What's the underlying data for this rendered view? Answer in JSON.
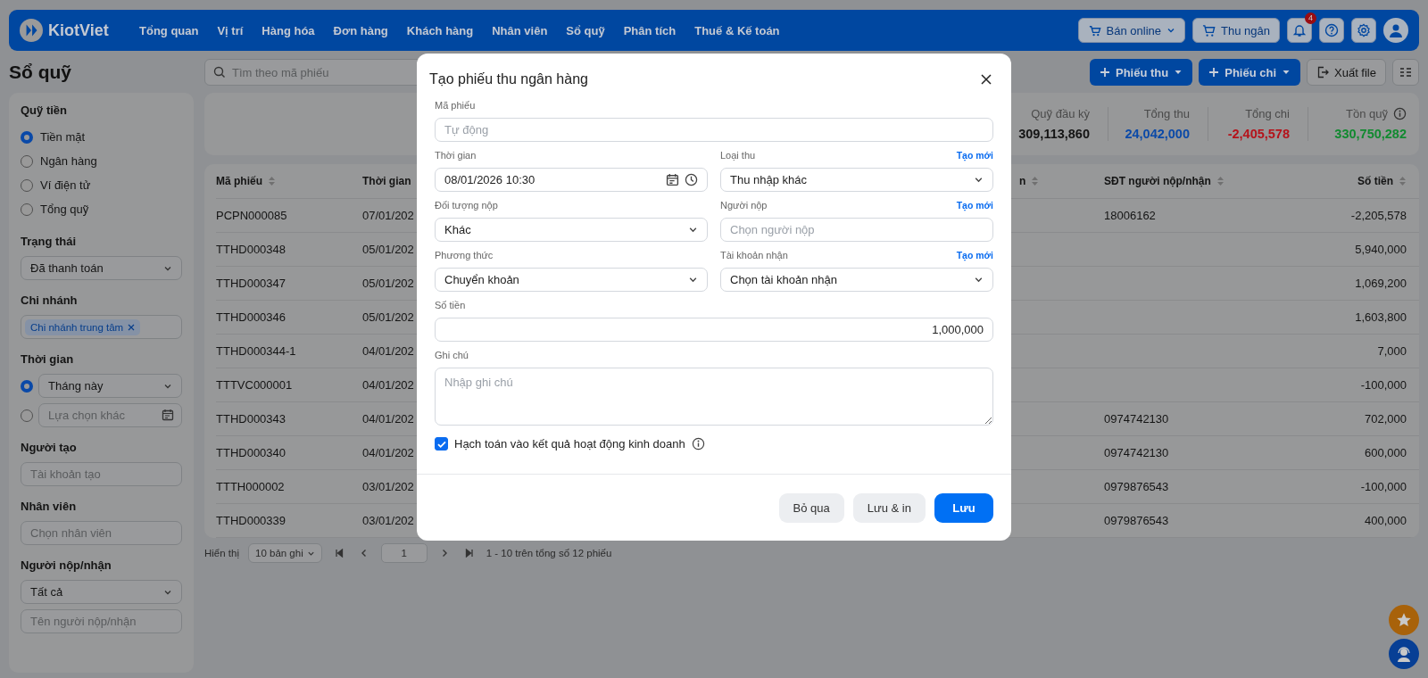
{
  "nav": {
    "logo": "KiotViet",
    "items": [
      {
        "label": "Tổng quan"
      },
      {
        "label": "Vị trí"
      },
      {
        "label": "Hàng hóa"
      },
      {
        "label": "Đơn hàng"
      },
      {
        "label": "Khách hàng"
      },
      {
        "label": "Nhân viên"
      },
      {
        "label": "Sổ quỹ"
      },
      {
        "label": "Phân tích"
      },
      {
        "label": "Thuế & Kế toán"
      }
    ],
    "online_button": "Bán online",
    "cashier_button": "Thu ngân",
    "notification_count": "4"
  },
  "page": {
    "title": "Sổ quỹ",
    "search": {
      "placeholder": "Tìm theo mã phiếu"
    },
    "receipt_button": "Phiếu thu",
    "payment_button": "Phiếu chi",
    "export_button": "Xuất file"
  },
  "sidebar": {
    "sections": [
      {
        "kind": "radios",
        "title": "Quỹ tiền",
        "options": [
          {
            "label": "Tiền mặt",
            "selected": true
          },
          {
            "label": "Ngân hàng",
            "selected": false
          },
          {
            "label": "Ví điện tử",
            "selected": false
          },
          {
            "label": "Tổng quỹ",
            "selected": false
          }
        ]
      },
      {
        "kind": "select",
        "title": "Trạng thái",
        "value": "Đã thanh toán"
      },
      {
        "kind": "tags",
        "title": "Chi nhánh",
        "tags": [
          "Chi nhánh trung tâm"
        ]
      },
      {
        "kind": "time",
        "title": "Thời gian",
        "options": [
          {
            "kind": "select",
            "value": "Tháng này",
            "selected": true
          },
          {
            "kind": "date",
            "placeholder": "Lựa chọn khác",
            "selected": false
          }
        ]
      },
      {
        "kind": "input",
        "title": "Người tạo",
        "placeholder": "Tài khoản tạo"
      },
      {
        "kind": "input",
        "title": "Nhân viên",
        "placeholder": "Chọn nhân viên"
      },
      {
        "kind": "select_input",
        "title": "Người nộp/nhận",
        "value": "Tất cả",
        "placeholder": "Tên người nộp/nhận"
      }
    ]
  },
  "summary": [
    {
      "label": "Quỹ đầu kỳ",
      "value": "309,113,860",
      "color": "#141414",
      "info": false
    },
    {
      "label": "Tổng thu",
      "value": "24,042,000",
      "color": "#0a49a8",
      "info": false
    },
    {
      "label": "Tổng chi",
      "value": "-2,405,578",
      "color": "#b5121a",
      "info": false
    },
    {
      "label": "Tồn quỹ",
      "value": "330,750,282",
      "color": "#118a30",
      "info": true
    }
  ],
  "table": {
    "columns": [
      {
        "label": "Mã phiếu"
      },
      {
        "label": "Thời gian"
      },
      {
        "label": "n"
      },
      {
        "label": "SĐT người nộp/nhận"
      },
      {
        "label": "Số tiền"
      }
    ],
    "rows": [
      {
        "code": "PCPN000085",
        "time": "07/01/202",
        "phone": "18006162",
        "amount": "-2,205,578"
      },
      {
        "code": "TTHD000348",
        "time": "05/01/202",
        "amount": "5,940,000"
      },
      {
        "code": "TTHD000347",
        "time": "05/01/202",
        "amount": "1,069,200"
      },
      {
        "code": "TTHD000346",
        "time": "05/01/202",
        "amount": "1,603,800"
      },
      {
        "code": "TTHD000344-1",
        "time": "04/01/202",
        "amount": "7,000"
      },
      {
        "code": "TTTVC000001",
        "time": "04/01/202",
        "amount": "-100,000"
      },
      {
        "code": "TTHD000343",
        "time": "04/01/202",
        "phone": "0974742130",
        "amount": "702,000"
      },
      {
        "code": "TTHD000340",
        "time": "04/01/202",
        "phone": "0974742130",
        "amount": "600,000"
      },
      {
        "code": "TTTH000002",
        "time": "03/01/202",
        "phone": "0979876543",
        "amount": "-100,000"
      },
      {
        "code": "TTHD000339",
        "time": "03/01/202",
        "phone": "0979876543",
        "amount": "400,000"
      }
    ]
  },
  "pagination": {
    "label": "Hiển thị",
    "page_size": "10 bản ghi",
    "page": "1",
    "summary": "1 - 10 trên tổng số 12 phiếu"
  },
  "modal": {
    "title": "Tạo phiếu thu ngân hàng",
    "rows": [
      [
        {
          "kind": "text",
          "label": "Mã phiếu",
          "placeholder": "Tự động"
        }
      ],
      [
        {
          "kind": "datetime",
          "label": "Thời gian",
          "value": "08/01/2026 10:30"
        },
        {
          "kind": "select",
          "label": "Loại thu",
          "value": "Thu nhập khác",
          "link": "Tạo mới"
        }
      ],
      [
        {
          "kind": "select",
          "label": "Đối tượng nộp",
          "value": "Khác"
        },
        {
          "kind": "text",
          "label": "Người nộp",
          "placeholder": "Chọn người nộp",
          "link": "Tạo mới"
        }
      ],
      [
        {
          "kind": "select",
          "label": "Phương thức",
          "value": "Chuyển khoản"
        },
        {
          "kind": "select",
          "label": "Tài khoản nhận",
          "value": "Chọn tài khoản nhận",
          "link": "Tạo mới"
        }
      ],
      [
        {
          "kind": "number",
          "label": "Số tiền",
          "value": "1,000,000"
        }
      ],
      [
        {
          "kind": "textarea",
          "label": "Ghi chú",
          "placeholder": "Nhập ghi chú"
        }
      ]
    ],
    "checkbox": {
      "label": "Hạch toán vào kết quả hoạt động kinh doanh",
      "checked": true,
      "info": true
    },
    "buttons": [
      {
        "label": "Bỏ qua",
        "kind": "secondary"
      },
      {
        "label": "Lưu & in",
        "kind": "secondary"
      },
      {
        "label": "Lưu",
        "kind": "primary"
      }
    ]
  }
}
